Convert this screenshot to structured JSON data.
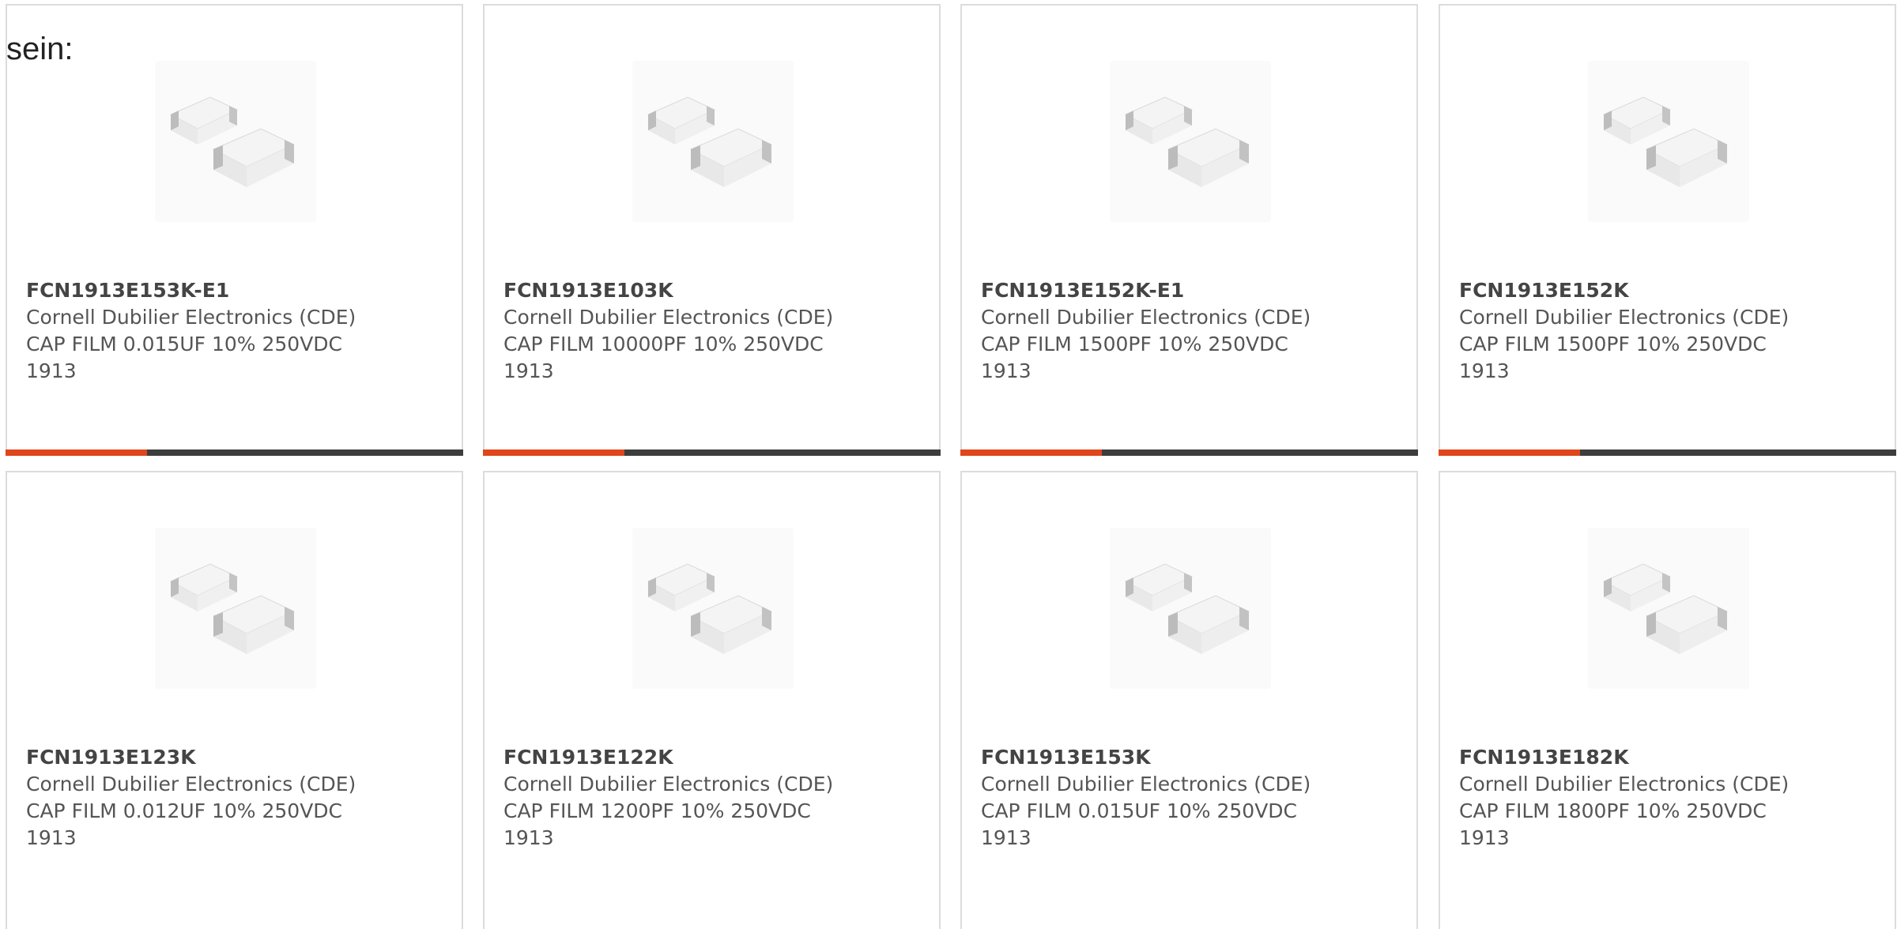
{
  "header": {
    "prefix_text": "sein:"
  },
  "theme": {
    "accent_color": "#e0461b",
    "bar_color": "#3d3d3d",
    "border_color": "#dcdcdc"
  },
  "products": [
    {
      "part_number": "FCN1913E153K-E1",
      "manufacturer": "Cornell Dubilier Electronics (CDE)",
      "description": "CAP FILM 0.015UF 10% 250VDC",
      "series": "1913",
      "image_icon": "capacitor-chip-image",
      "accent_fill": 0.31
    },
    {
      "part_number": "FCN1913E103K",
      "manufacturer": "Cornell Dubilier Electronics (CDE)",
      "description": "CAP FILM 10000PF 10% 250VDC",
      "series": "1913",
      "image_icon": "capacitor-chip-image",
      "accent_fill": 0.31
    },
    {
      "part_number": "FCN1913E152K-E1",
      "manufacturer": "Cornell Dubilier Electronics (CDE)",
      "description": "CAP FILM 1500PF 10% 250VDC",
      "series": "1913",
      "image_icon": "capacitor-chip-image",
      "accent_fill": 0.31
    },
    {
      "part_number": "FCN1913E152K",
      "manufacturer": "Cornell Dubilier Electronics (CDE)",
      "description": "CAP FILM 1500PF 10% 250VDC",
      "series": "1913",
      "image_icon": "capacitor-chip-image",
      "accent_fill": 0.31
    },
    {
      "part_number": "FCN1913E123K",
      "manufacturer": "Cornell Dubilier Electronics (CDE)",
      "description": "CAP FILM 0.012UF 10% 250VDC",
      "series": "1913",
      "image_icon": "capacitor-chip-image"
    },
    {
      "part_number": "FCN1913E122K",
      "manufacturer": "Cornell Dubilier Electronics (CDE)",
      "description": "CAP FILM 1200PF 10% 250VDC",
      "series": "1913",
      "image_icon": "capacitor-chip-image"
    },
    {
      "part_number": "FCN1913E153K",
      "manufacturer": "Cornell Dubilier Electronics (CDE)",
      "description": "CAP FILM 0.015UF 10% 250VDC",
      "series": "1913",
      "image_icon": "capacitor-chip-image"
    },
    {
      "part_number": "FCN1913E182K",
      "manufacturer": "Cornell Dubilier Electronics (CDE)",
      "description": "CAP FILM 1800PF 10% 250VDC",
      "series": "1913",
      "image_icon": "capacitor-chip-image"
    }
  ]
}
